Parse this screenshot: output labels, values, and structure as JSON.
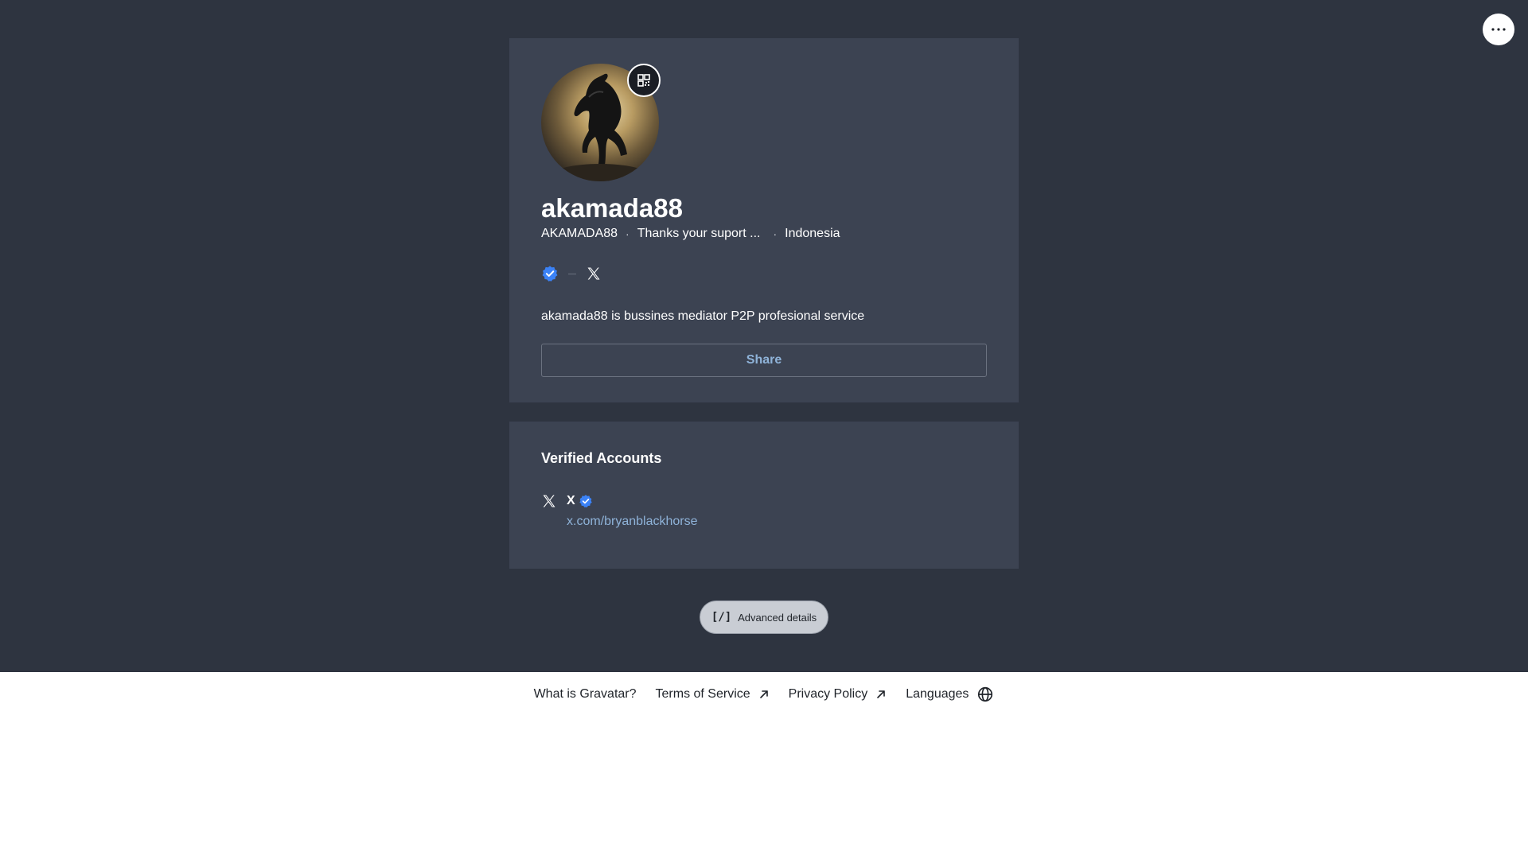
{
  "header": {
    "menu_icon": "more-horizontal-icon"
  },
  "profile": {
    "avatar_icon": "horse-avatar-image",
    "qr_icon": "qr-code-icon",
    "display_name": "akamada88",
    "username": "AKAMADA88",
    "tagline": "Thanks your suport ...",
    "location": "Indonesia",
    "verified_icon": "verified-badge-icon",
    "social_icon": "x-logo-icon",
    "bio": "akamada88 is bussines mediator P2P profesional service",
    "share_label": "Share"
  },
  "verified_accounts": {
    "title": "Verified Accounts",
    "items": [
      {
        "service": "X",
        "icon": "x-logo-icon",
        "verified_icon": "verified-badge-icon",
        "url": "x.com/bryanblackhorse"
      }
    ]
  },
  "advanced": {
    "icon_text": "[/]",
    "label": "Advanced details"
  },
  "footer": {
    "links": [
      {
        "label": "What is Gravatar?"
      },
      {
        "label": "Terms of Service",
        "icon": "external-link-icon"
      },
      {
        "label": "Privacy Policy",
        "icon": "external-link-icon"
      },
      {
        "label": "Languages",
        "icon": "globe-icon"
      }
    ]
  },
  "colors": {
    "background_dark": "#2e3440",
    "card": "#3c4352",
    "link": "#8fb3d9",
    "verified": "#3b82f6"
  }
}
